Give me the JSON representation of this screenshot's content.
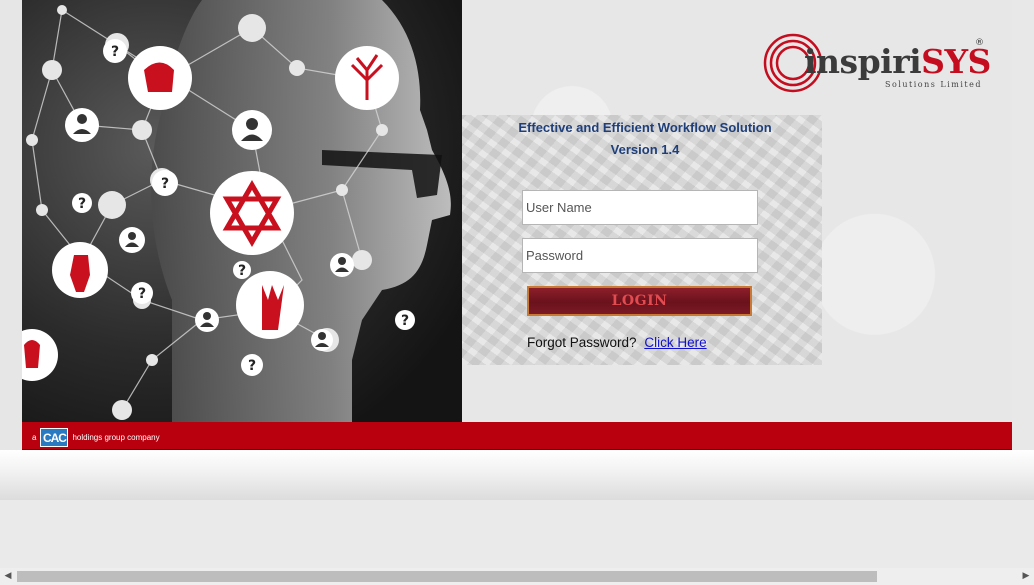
{
  "brand": {
    "logo_main": "inspiri",
    "logo_accent": "SYS",
    "logo_registered": "®",
    "logo_sub": "Solutions Limited"
  },
  "login": {
    "heading_line1": "Effective and Efficient Workflow Solution",
    "heading_line2": "Version 1.4",
    "username_placeholder": "User Name",
    "password_placeholder": "Password",
    "login_label": "LOGIN",
    "forgot_text": "Forgot Password?",
    "forgot_link": "Click Here"
  },
  "footer": {
    "prefix": "a",
    "cac_label": "CAC",
    "suffix": "holdings group company"
  },
  "hero": {
    "question_marks": [
      "?",
      "?",
      "?",
      "?",
      "?",
      "?",
      "?",
      "?"
    ]
  },
  "colors": {
    "accent_red": "#b8000e",
    "heading_blue": "#1f3f7a",
    "link_blue": "#1111cc"
  }
}
